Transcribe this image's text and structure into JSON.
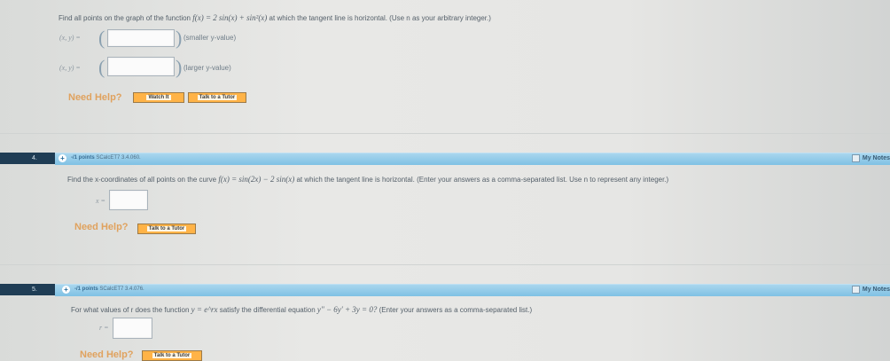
{
  "q3": {
    "prompt_prefix": "Find all points on the graph of the function",
    "function": "f(x) = 2 sin(x) + sin²(x)",
    "prompt_suffix": "at which the tangent line is horizontal. (Use n as your arbitrary integer.)",
    "row1_label": "(x, y) =",
    "row1_hint": "(smaller y-value)",
    "row2_label": "(x, y) =",
    "row2_hint": "(larger y-value)",
    "need_help": "Need Help?",
    "watch_label": "Watch It",
    "tutor_label": "Talk to a Tutor"
  },
  "q4": {
    "number": "4.",
    "points": "-/1 points",
    "code": "SCalcET7 3.4.060.",
    "my_notes": "My Notes",
    "prompt_prefix": "Find the x-coordinates of all points on the curve",
    "function": "f(x) = sin(2x) − 2 sin(x)",
    "prompt_suffix": "at which the tangent line is horizontal. (Enter your answers as a comma-separated list. Use n to represent any integer.)",
    "answer_label": "x =",
    "need_help": "Need Help?",
    "tutor_label": "Talk to a Tutor"
  },
  "q5": {
    "number": "5.",
    "points": "-/1 points",
    "code": "SCalcET7 3.4.076.",
    "my_notes": "My Notes",
    "prompt_prefix": "For what values of r does the function",
    "function": "y = e^rx",
    "prompt_mid": "satisfy the differential equation",
    "equation": "y'' − 6y' + 3y = 0?",
    "prompt_suffix": "(Enter your answers as a comma-separated list.)",
    "answer_label": "r =",
    "need_help": "Need Help?",
    "tutor_label": "Talk to a Tutor"
  }
}
